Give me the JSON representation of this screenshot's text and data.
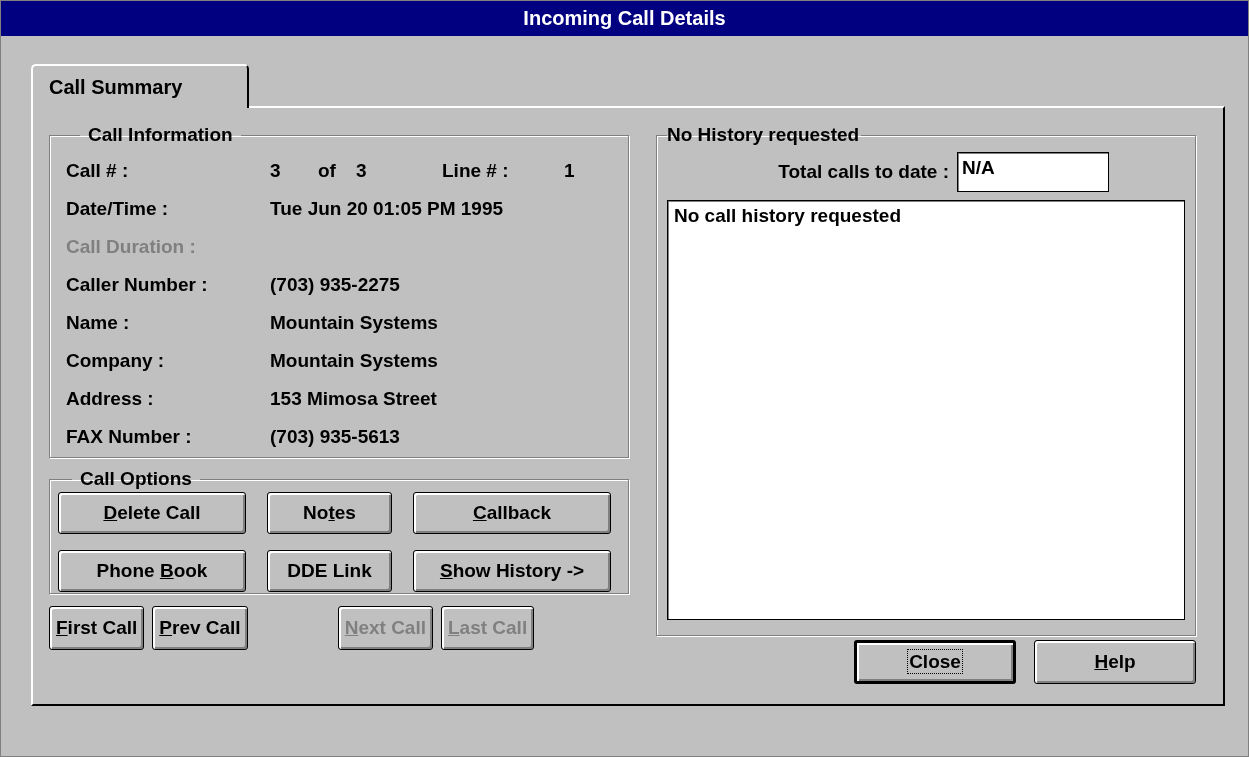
{
  "window": {
    "title": "Incoming Call Details"
  },
  "tabs": [
    {
      "label": "Call Summary",
      "selected": true
    }
  ],
  "call_information": {
    "title": "Call Information",
    "call_row": {
      "label": "Call # :",
      "current": "3",
      "of": "of",
      "total": "3",
      "line_label": "Line # :",
      "line": "1"
    },
    "rows": [
      {
        "label": "Date/Time :",
        "value": "Tue Jun 20 01:05 PM 1995",
        "disabled": false
      },
      {
        "label": "Call Duration :",
        "disabled": true
      },
      {
        "label": "Caller Number :",
        "value": "(703) 935-2275",
        "disabled": false
      },
      {
        "label": "Name :",
        "value": "Mountain Systems",
        "disabled": false
      },
      {
        "label": "Company :",
        "value": "Mountain Systems",
        "disabled": false
      },
      {
        "label": "Address :",
        "value": "153 Mimosa Street",
        "disabled": false
      },
      {
        "label": "FAX Number :",
        "value": "(703) 935-5613",
        "disabled": false
      }
    ]
  },
  "call_options": {
    "title": "Call Options",
    "buttons": [
      {
        "label": [
          {
            "text": "D",
            "underlined": true
          },
          {
            "text": "elete Call",
            "underlined": false
          }
        ]
      },
      {
        "label": [
          {
            "text": "No",
            "underlined": false
          },
          {
            "text": "t",
            "underlined": true
          },
          {
            "text": "es",
            "underlined": false
          }
        ]
      },
      {
        "label": [
          {
            "text": "C",
            "underlined": true
          },
          {
            "text": "allback",
            "underlined": false
          }
        ]
      },
      {
        "label": [
          {
            "text": "Phone ",
            "underlined": false
          },
          {
            "text": "B",
            "underlined": true
          },
          {
            "text": "ook",
            "underlined": false
          }
        ]
      },
      {
        "label": [
          {
            "text": "DDE Link",
            "underlined": false
          }
        ]
      },
      {
        "label": [
          {
            "text": "S",
            "underlined": true
          },
          {
            "text": "how History ->",
            "underlined": false
          }
        ]
      }
    ]
  },
  "navigation": [
    {
      "label": [
        {
          "text": "F",
          "underlined": true
        },
        {
          "text": "irst Call",
          "underlined": false
        }
      ],
      "disabled": false
    },
    {
      "label": [
        {
          "text": "P",
          "underlined": true
        },
        {
          "text": "rev Call",
          "underlined": false
        }
      ],
      "disabled": false
    },
    {
      "label": [
        {
          "text": "N",
          "underlined": true
        },
        {
          "text": "ext Call",
          "underlined": false
        }
      ],
      "disabled": true
    },
    {
      "label": [
        {
          "text": "L",
          "underlined": true
        },
        {
          "text": "ast Call",
          "underlined": false
        }
      ],
      "disabled": true
    }
  ],
  "history": {
    "title": "No History requested",
    "total_label": "Total calls to date :",
    "total_value": "N/A",
    "list_text": "No call history requested"
  },
  "buttons": [
    {
      "label": [
        {
          "text": "Close",
          "underlined": false
        }
      ],
      "default": true
    },
    {
      "label": [
        {
          "text": "H",
          "underlined": true
        },
        {
          "text": "elp",
          "underlined": false
        }
      ],
      "default": false
    }
  ]
}
